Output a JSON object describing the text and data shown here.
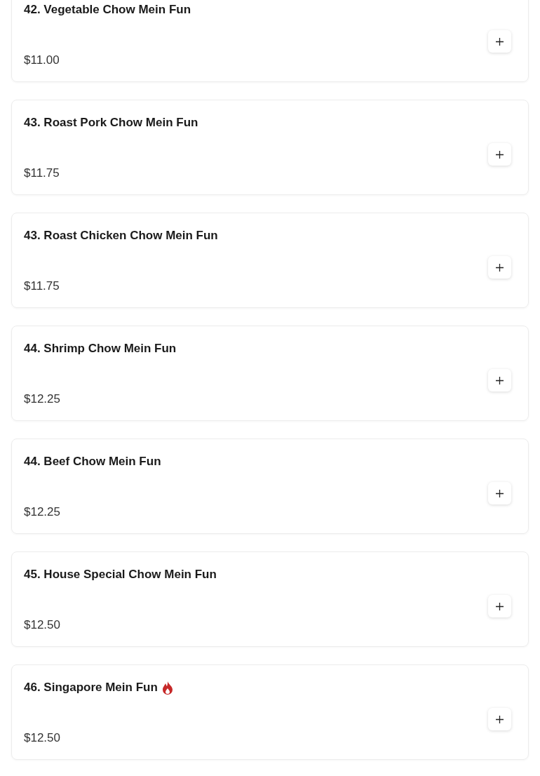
{
  "items": [
    {
      "name": "42. Vegetable Chow Mein Fun",
      "price": "$11.00",
      "spicy": false
    },
    {
      "name": "43. Roast Pork Chow Mein Fun",
      "price": "$11.75",
      "spicy": false
    },
    {
      "name": "43. Roast Chicken Chow Mein Fun",
      "price": "$11.75",
      "spicy": false
    },
    {
      "name": "44. Shrimp Chow Mein Fun",
      "price": "$12.25",
      "spicy": false
    },
    {
      "name": "44. Beef Chow Mein Fun",
      "price": "$12.25",
      "spicy": false
    },
    {
      "name": "45. House Special Chow Mein Fun",
      "price": "$12.50",
      "spicy": false
    },
    {
      "name": "46. Singapore Mein Fun",
      "price": "$12.50",
      "spicy": true
    }
  ]
}
